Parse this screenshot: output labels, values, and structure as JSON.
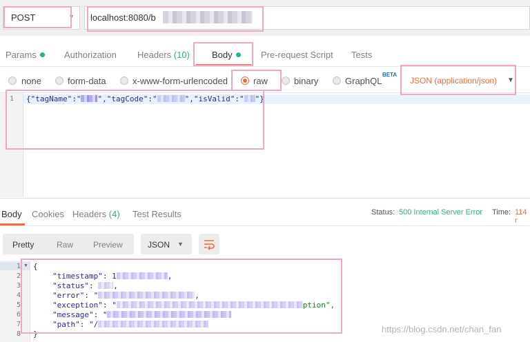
{
  "request": {
    "method": "POST",
    "url_visible": "localhost:8080/b"
  },
  "request_tabs": [
    {
      "label": "Params",
      "dot": true
    },
    {
      "label": "Authorization"
    },
    {
      "label": "Headers",
      "count": "(10)"
    },
    {
      "label": "Body",
      "dot": true,
      "active": true
    },
    {
      "label": "Pre-request Script"
    },
    {
      "label": "Tests"
    }
  ],
  "body_types": [
    {
      "label": "none"
    },
    {
      "label": "form-data"
    },
    {
      "label": "x-www-form-urlencoded"
    },
    {
      "label": "raw",
      "selected": true
    },
    {
      "label": "binary"
    },
    {
      "label": "GraphQL",
      "badge": "BETA"
    }
  ],
  "content_type": "JSON (application/json)",
  "request_body": {
    "line_number": "1",
    "k1": "{\"tagName\":\"",
    "k2": "\",\"tagCode\":\"",
    "k3": "\",\"isValid\":\"",
    "k4": "\"}"
  },
  "response_tabs": [
    {
      "label": "Body",
      "active": true
    },
    {
      "label": "Cookies"
    },
    {
      "label": "Headers",
      "count": "(4)"
    },
    {
      "label": "Test Results"
    }
  ],
  "status": {
    "status_label": "Status:",
    "status_value": "500 Internal Server Error",
    "time_label": "Time:",
    "time_value": "114 r"
  },
  "view_modes": [
    "Pretty",
    "Raw",
    "Preview"
  ],
  "format": "JSON",
  "response_body": {
    "line_numbers": [
      "1",
      "2",
      "3",
      "4",
      "5",
      "6",
      "7",
      "8"
    ],
    "open_brace": "{",
    "timestamp_key": "\"timestamp\": 1",
    "status_key": "\"status\": ",
    "error_key": "\"error\": \"",
    "exception_key": "\"exception\": \"",
    "exception_tail": "ption\",",
    "message_key": "\"message\": \"",
    "path_key": "\"path\": \"/",
    "close_brace": "}"
  },
  "watermark": "https://blog.csdn.net/chan_fan",
  "colors": {
    "accent": "#f26b3a",
    "success": "#26b47f",
    "annotation": "#f3a6c3"
  }
}
